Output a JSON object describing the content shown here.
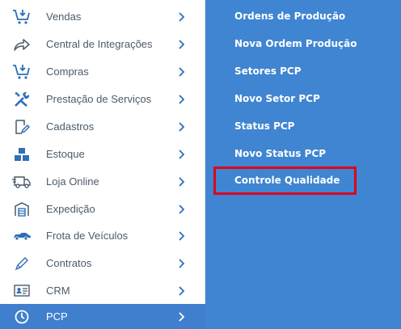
{
  "sidebar": {
    "items": [
      {
        "label": "Vendas",
        "icon": "cart-download-icon"
      },
      {
        "label": "Central de Integrações",
        "icon": "share-arrow-icon"
      },
      {
        "label": "Compras",
        "icon": "cart-download-icon"
      },
      {
        "label": "Prestação de Serviços",
        "icon": "tools-icon"
      },
      {
        "label": "Cadastros",
        "icon": "edit-document-icon"
      },
      {
        "label": "Estoque",
        "icon": "boxes-icon"
      },
      {
        "label": "Loja Online",
        "icon": "delivery-truck-icon"
      },
      {
        "label": "Expedição",
        "icon": "warehouse-icon"
      },
      {
        "label": "Frota de Veículos",
        "icon": "car-icon"
      },
      {
        "label": "Contratos",
        "icon": "pen-icon"
      },
      {
        "label": "CRM",
        "icon": "id-card-icon"
      },
      {
        "label": "PCP",
        "icon": "clock-icon",
        "active": true
      }
    ]
  },
  "submenu": {
    "items": [
      {
        "label": "Ordens de Produção"
      },
      {
        "label": "Nova Ordem Produção"
      },
      {
        "label": "Setores PCP"
      },
      {
        "label": "Novo Setor PCP"
      },
      {
        "label": "Status PCP"
      },
      {
        "label": "Novo Status PCP"
      },
      {
        "label": "Controle Qualidade",
        "highlighted": true
      }
    ]
  },
  "colors": {
    "submenu_bg": "#3f85d2",
    "active_bg": "#3f7fce",
    "highlight_border": "#e0001b",
    "icon_color": "#2f6fb8"
  }
}
